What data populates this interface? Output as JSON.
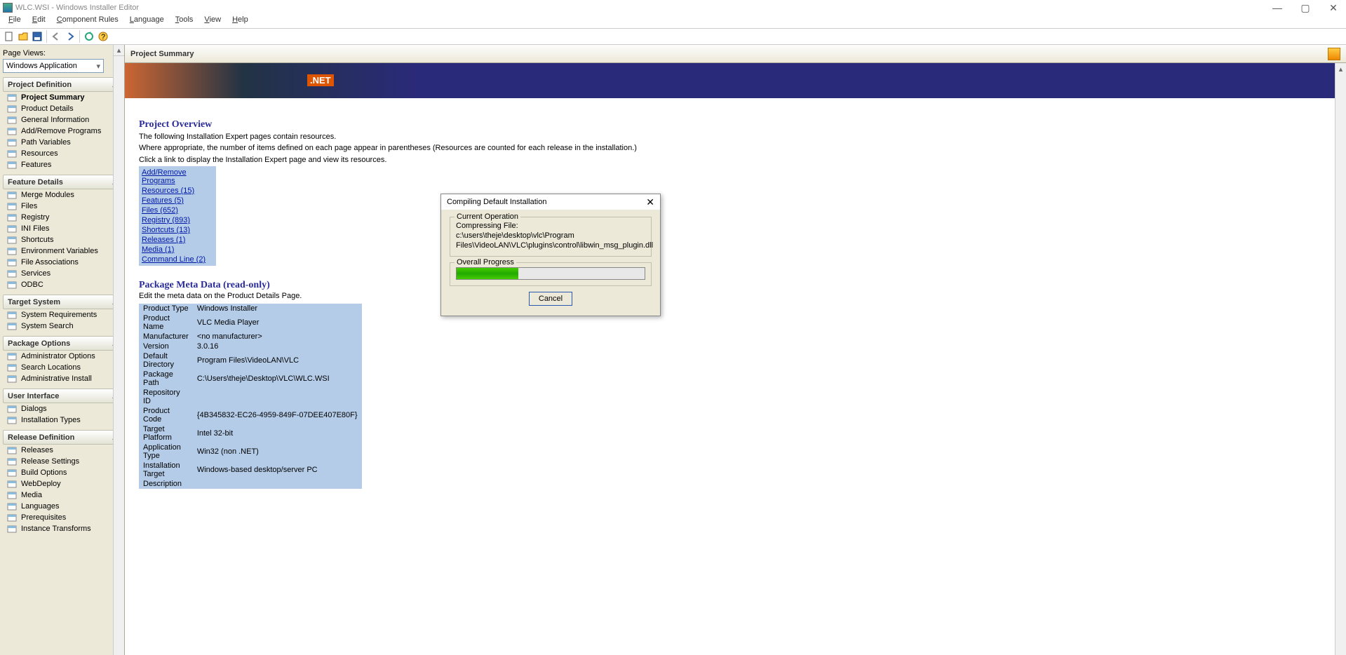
{
  "window": {
    "title": "WLC.WSI - Windows Installer Editor"
  },
  "menus": [
    "File",
    "Edit",
    "Component Rules",
    "Language",
    "Tools",
    "View",
    "Help"
  ],
  "page_views_label": "Page Views:",
  "page_views_value": "Windows Application",
  "sections": {
    "project_definition": {
      "title": "Project Definition",
      "items": [
        "Project Summary",
        "Product Details",
        "General Information",
        "Add/Remove Programs",
        "Path Variables",
        "Resources",
        "Features"
      ]
    },
    "feature_details": {
      "title": "Feature Details",
      "items": [
        "Merge Modules",
        "Files",
        "Registry",
        "INI Files",
        "Shortcuts",
        "Environment Variables",
        "File Associations",
        "Services",
        "ODBC"
      ]
    },
    "target_system": {
      "title": "Target System",
      "items": [
        "System Requirements",
        "System Search"
      ]
    },
    "package_options": {
      "title": "Package Options",
      "items": [
        "Administrator Options",
        "Search Locations",
        "Administrative Install"
      ]
    },
    "user_interface": {
      "title": "User Interface",
      "items": [
        "Dialogs",
        "Installation Types"
      ]
    },
    "release_definition": {
      "title": "Release Definition",
      "items": [
        "Releases",
        "Release Settings",
        "Build Options",
        "WebDeploy",
        "Media",
        "Languages",
        "Prerequisites",
        "Instance Transforms"
      ]
    }
  },
  "summary": {
    "header": "Project Summary",
    "overview_title": "Project Overview",
    "overview_desc1": "The following Installation Expert pages contain resources.",
    "overview_desc2": "Where appropriate, the number of items defined on each page appear in parentheses (Resources are counted for each release in the installation.)",
    "overview_desc3": "Click a link to display the Installation Expert page and view its resources.",
    "links": [
      "Add/Remove Programs",
      "Resources (15)",
      "Features (5)",
      "Files (652)",
      "Registry (893)",
      "Shortcuts (13)",
      "Releases (1)",
      "Media (1)",
      "Command Line (2)"
    ],
    "meta_title": "Package Meta Data (read-only)",
    "meta_desc": "Edit the meta data on the Product Details Page.",
    "meta": [
      {
        "k": "Product Type",
        "v": "Windows Installer"
      },
      {
        "k": "Product Name",
        "v": "VLC Media Player"
      },
      {
        "k": "Manufacturer",
        "v": "<no manufacturer>"
      },
      {
        "k": "Version",
        "v": "3.0.16"
      },
      {
        "k": "Default Directory",
        "v": "Program Files\\VideoLAN\\VLC"
      },
      {
        "k": "Package Path",
        "v": "C:\\Users\\theje\\Desktop\\VLC\\WLC.WSI"
      },
      {
        "k": "Repository ID",
        "v": ""
      },
      {
        "k": "Product Code",
        "v": "{4B345832-EC26-4959-849F-07DEE407E80F}"
      },
      {
        "k": "Target Platform",
        "v": "Intel 32-bit"
      },
      {
        "k": "Application Type",
        "v": "Win32 (non .NET)"
      },
      {
        "k": "Installation Target",
        "v": "Windows-based desktop/server PC"
      },
      {
        "k": "Description",
        "v": ""
      }
    ]
  },
  "dialog": {
    "title": "Compiling Default Installation",
    "current_op_label": "Current Operation",
    "compressing_label": "Compressing File:",
    "file_line1": "c:\\users\\theje\\desktop\\vlc\\Program",
    "file_line2": "Files\\VideoLAN\\VLC\\plugins\\control\\libwin_msg_plugin.dll",
    "overall_label": "Overall Progress",
    "progress_percent": 33,
    "cancel": "Cancel"
  }
}
